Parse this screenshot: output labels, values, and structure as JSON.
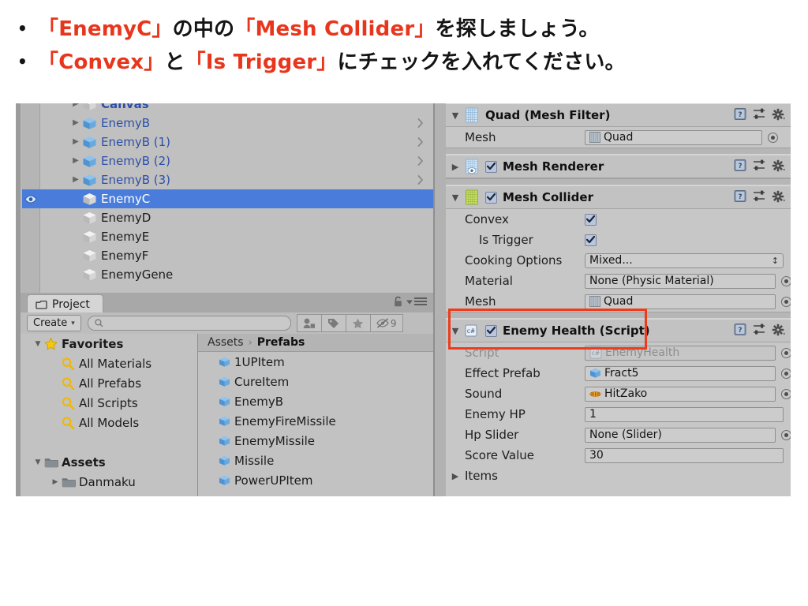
{
  "slide": {
    "bullets": [
      {
        "marker": "•",
        "parts": [
          {
            "t": "「EnemyC」",
            "hl": true
          },
          {
            "t": "の中の",
            "hl": false
          },
          {
            "t": "「Mesh Collider」",
            "hl": true
          },
          {
            "t": "を探しましょう。",
            "hl": false
          }
        ]
      },
      {
        "marker": "•",
        "parts": [
          {
            "t": "「Convex」",
            "hl": true
          },
          {
            "t": "と",
            "hl": false
          },
          {
            "t": "「Is Trigger」",
            "hl": true
          },
          {
            "t": "にチェックを入れてください。",
            "hl": false
          }
        ]
      }
    ],
    "highlight_color": "#e8361c",
    "text_color": "#141414"
  },
  "hierarchy": {
    "selection_color": "#4a7ddb",
    "highlight_box_color": "#ee3b1c",
    "rows": [
      {
        "name": "Canvas",
        "twisty": "▶",
        "prefab": false,
        "selected": false,
        "chevron": false,
        "eye": false,
        "cut": true
      },
      {
        "name": "EnemyB",
        "twisty": "▶",
        "prefab": true,
        "selected": false,
        "chevron": true,
        "eye": false
      },
      {
        "name": "EnemyB (1)",
        "twisty": "▶",
        "prefab": true,
        "selected": false,
        "chevron": true,
        "eye": false
      },
      {
        "name": "EnemyB (2)",
        "twisty": "▶",
        "prefab": true,
        "selected": false,
        "chevron": true,
        "eye": false
      },
      {
        "name": "EnemyB (3)",
        "twisty": "▶",
        "prefab": true,
        "selected": false,
        "chevron": true,
        "eye": false
      },
      {
        "name": "EnemyC",
        "twisty": "",
        "prefab": false,
        "selected": true,
        "chevron": false,
        "eye": true
      },
      {
        "name": "EnemyD",
        "twisty": "",
        "prefab": false,
        "selected": false,
        "chevron": false,
        "eye": false
      },
      {
        "name": "EnemyE",
        "twisty": "",
        "prefab": false,
        "selected": false,
        "chevron": false,
        "eye": false
      },
      {
        "name": "EnemyF",
        "twisty": "",
        "prefab": false,
        "selected": false,
        "chevron": false,
        "eye": false
      },
      {
        "name": "EnemyGene",
        "twisty": "",
        "prefab": false,
        "selected": false,
        "chevron": false,
        "eye": false
      }
    ]
  },
  "project": {
    "tab_label": "Project",
    "create_label": "Create",
    "create_caret": "▾",
    "search_value": "",
    "search_placeholder": "",
    "hidden_count": "9",
    "tree": [
      {
        "label": "Favorites",
        "twisty": "▼",
        "icon": "star-icon",
        "bold": true,
        "indent": false
      },
      {
        "label": "All Materials",
        "twisty": "",
        "icon": "search-icon",
        "bold": false,
        "indent": true
      },
      {
        "label": "All Prefabs",
        "twisty": "",
        "icon": "search-icon",
        "bold": false,
        "indent": true
      },
      {
        "label": "All Scripts",
        "twisty": "",
        "icon": "search-icon",
        "bold": false,
        "indent": true
      },
      {
        "label": "All Models",
        "twisty": "",
        "icon": "search-icon",
        "bold": false,
        "indent": true
      },
      {
        "label": "",
        "twisty": "",
        "icon": "none",
        "bold": false,
        "indent": false
      },
      {
        "label": "Assets",
        "twisty": "▼",
        "icon": "folder-icon",
        "bold": true,
        "indent": false
      },
      {
        "label": "Danmaku",
        "twisty": "▶",
        "icon": "folder-icon",
        "bold": false,
        "indent": true
      }
    ],
    "breadcrumb": {
      "root": "Assets",
      "sep": "›",
      "current": "Prefabs"
    },
    "assets": [
      "1UPItem",
      "CureItem",
      "EnemyB",
      "EnemyFireMissile",
      "EnemyMissile",
      "Missile",
      "PowerUPItem"
    ]
  },
  "inspector": {
    "highlight_box_color": "#ee3b1c",
    "components": [
      {
        "title": "Quad (Mesh Filter)",
        "icon": "mesh-filter-icon",
        "twisty": "▼",
        "has_checkbox": false,
        "checked": false,
        "fields": [
          {
            "label": "Mesh",
            "kind": "object",
            "value": "Quad",
            "icon": "mesh-icon",
            "picker": true,
            "width": "w1"
          }
        ]
      },
      {
        "title": "Mesh Renderer",
        "icon": "mesh-renderer-icon",
        "twisty": "▶",
        "has_checkbox": true,
        "checked": true,
        "fields": []
      },
      {
        "title": "Mesh Collider",
        "icon": "mesh-collider-icon",
        "twisty": "▼",
        "has_checkbox": true,
        "checked": true,
        "fields": [
          {
            "label": "Convex",
            "kind": "checkbox",
            "checked": true,
            "indent": false
          },
          {
            "label": "Is Trigger",
            "kind": "checkbox",
            "checked": true,
            "indent": true
          },
          {
            "label": "Cooking Options",
            "kind": "dropdown",
            "value": "Mixed...",
            "caret": "⬍"
          },
          {
            "label": "Material",
            "kind": "object",
            "value": "None (Physic Material)",
            "icon": "none",
            "picker": true,
            "width": "w2"
          },
          {
            "label": "Mesh",
            "kind": "object",
            "value": "Quad",
            "icon": "mesh-icon",
            "picker": true,
            "width": "w2"
          }
        ]
      },
      {
        "title": "Enemy Health (Script)",
        "icon": "csharp-script-icon",
        "twisty": "▼",
        "has_checkbox": true,
        "checked": true,
        "fields": [
          {
            "label": "Script",
            "kind": "object",
            "value": "EnemyHealth",
            "icon": "csharp-script-icon",
            "picker": true,
            "width": "w2",
            "dim": true
          },
          {
            "label": "Effect Prefab",
            "kind": "object",
            "value": "Fract5",
            "icon": "prefab-cube-icon",
            "picker": true,
            "width": "w2"
          },
          {
            "label": "Sound",
            "kind": "object",
            "value": "HitZako",
            "icon": "audio-clip-icon",
            "picker": true,
            "width": "w2"
          },
          {
            "label": "Enemy HP",
            "kind": "text",
            "value": "1",
            "width": "w3"
          },
          {
            "label": "Hp Slider",
            "kind": "object",
            "value": "None (Slider)",
            "icon": "none",
            "picker": true,
            "width": "w2"
          },
          {
            "label": "Score Value",
            "kind": "text",
            "value": "30",
            "width": "w3"
          },
          {
            "label": "Items",
            "kind": "foldout",
            "twisty": "▶"
          }
        ]
      }
    ],
    "header_icons": [
      "help-icon",
      "preset-icon",
      "gear-icon"
    ]
  }
}
